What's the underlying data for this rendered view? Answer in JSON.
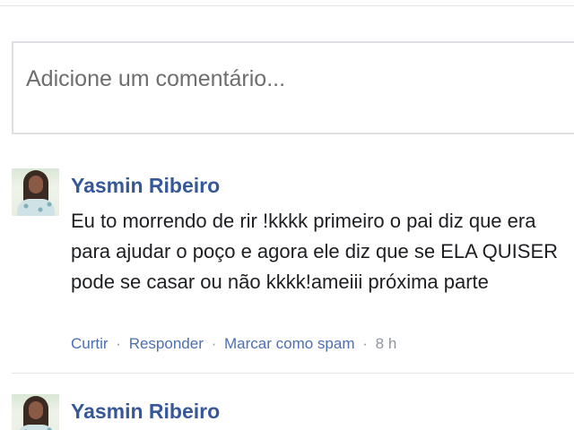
{
  "comment_composer": {
    "placeholder": "Adicione um comentário..."
  },
  "comments": [
    {
      "author": "Yasmin Ribeiro",
      "text": "Eu to morrendo de rir !kkkk primeiro o pai diz que era para ajudar o poço e agora ele diz que se ELA QUISER pode se casar ou não kkkk!ameiii próxima parte",
      "actions": {
        "like": "Curtir",
        "reply": "Responder",
        "spam": "Marcar como spam",
        "separator": "·",
        "time": "8 h"
      }
    },
    {
      "author": "Yasmin Ribeiro"
    }
  ],
  "colors": {
    "author_name": "#365899",
    "action_link": "#4b6fb3",
    "meta_text": "#90949c",
    "border": "#dddfe2"
  }
}
